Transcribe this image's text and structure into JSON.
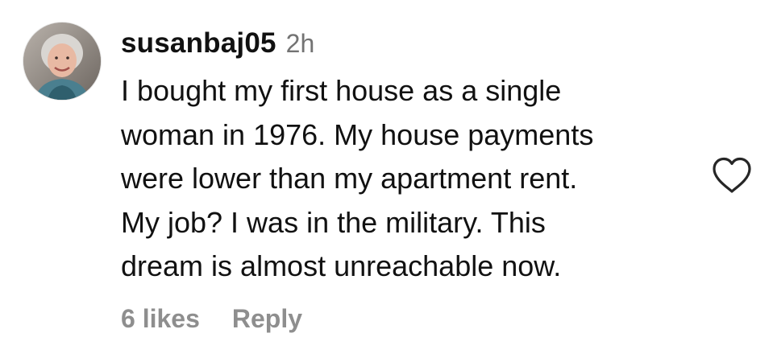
{
  "comment": {
    "username": "susanbaj05",
    "timestamp": "2h",
    "text_lines": [
      "I bought my first house as a single",
      "woman in 1976. My house payments",
      "were lower than my apartment rent.",
      "My job? I was in the military. This",
      "dream is almost unreachable now."
    ],
    "likes": "6 likes",
    "reply_label": "Reply",
    "like_icon": "heart-outline-icon",
    "avatar_icon": "user-avatar"
  },
  "colors": {
    "primary_text": "#111111",
    "secondary_text": "#737373",
    "footer_text": "#8e8e8e",
    "icon_stroke": "#262626"
  }
}
